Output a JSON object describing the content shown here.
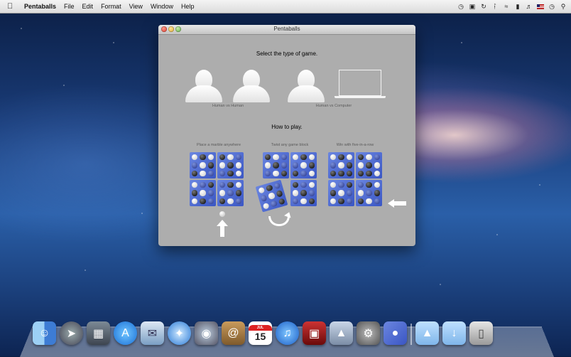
{
  "menubar": {
    "app_name": "Pentaballs",
    "menus": [
      "File",
      "Edit",
      "Format",
      "View",
      "Window",
      "Help"
    ],
    "status_icons": [
      "time-machine-icon",
      "notes-icon",
      "sync-icon",
      "bluetooth-icon",
      "wifi-icon",
      "battery-icon",
      "volume-icon",
      "flag-icon",
      "clock-icon",
      "search-icon"
    ]
  },
  "window": {
    "title": "Pentaballs",
    "select_heading": "Select the type of game.",
    "options": [
      {
        "label": "Human vs Human"
      },
      {
        "label": "Human vs Computer"
      }
    ],
    "howto_heading": "How to play.",
    "steps": [
      {
        "caption": "Place a marble anywhere"
      },
      {
        "caption": "Twist any game block"
      },
      {
        "caption": "Win with five-in-a-row"
      }
    ]
  },
  "dock": {
    "calendar_day": "15",
    "calendar_month": "JUL",
    "items": [
      "finder",
      "launchpad",
      "mission-control",
      "app-store",
      "mail",
      "safari",
      "facetime",
      "address-book",
      "calendar",
      "itunes",
      "photo-booth",
      "iphoto",
      "system-preferences",
      "pentaballs",
      "applications-folder",
      "downloads-folder",
      "trash"
    ]
  }
}
